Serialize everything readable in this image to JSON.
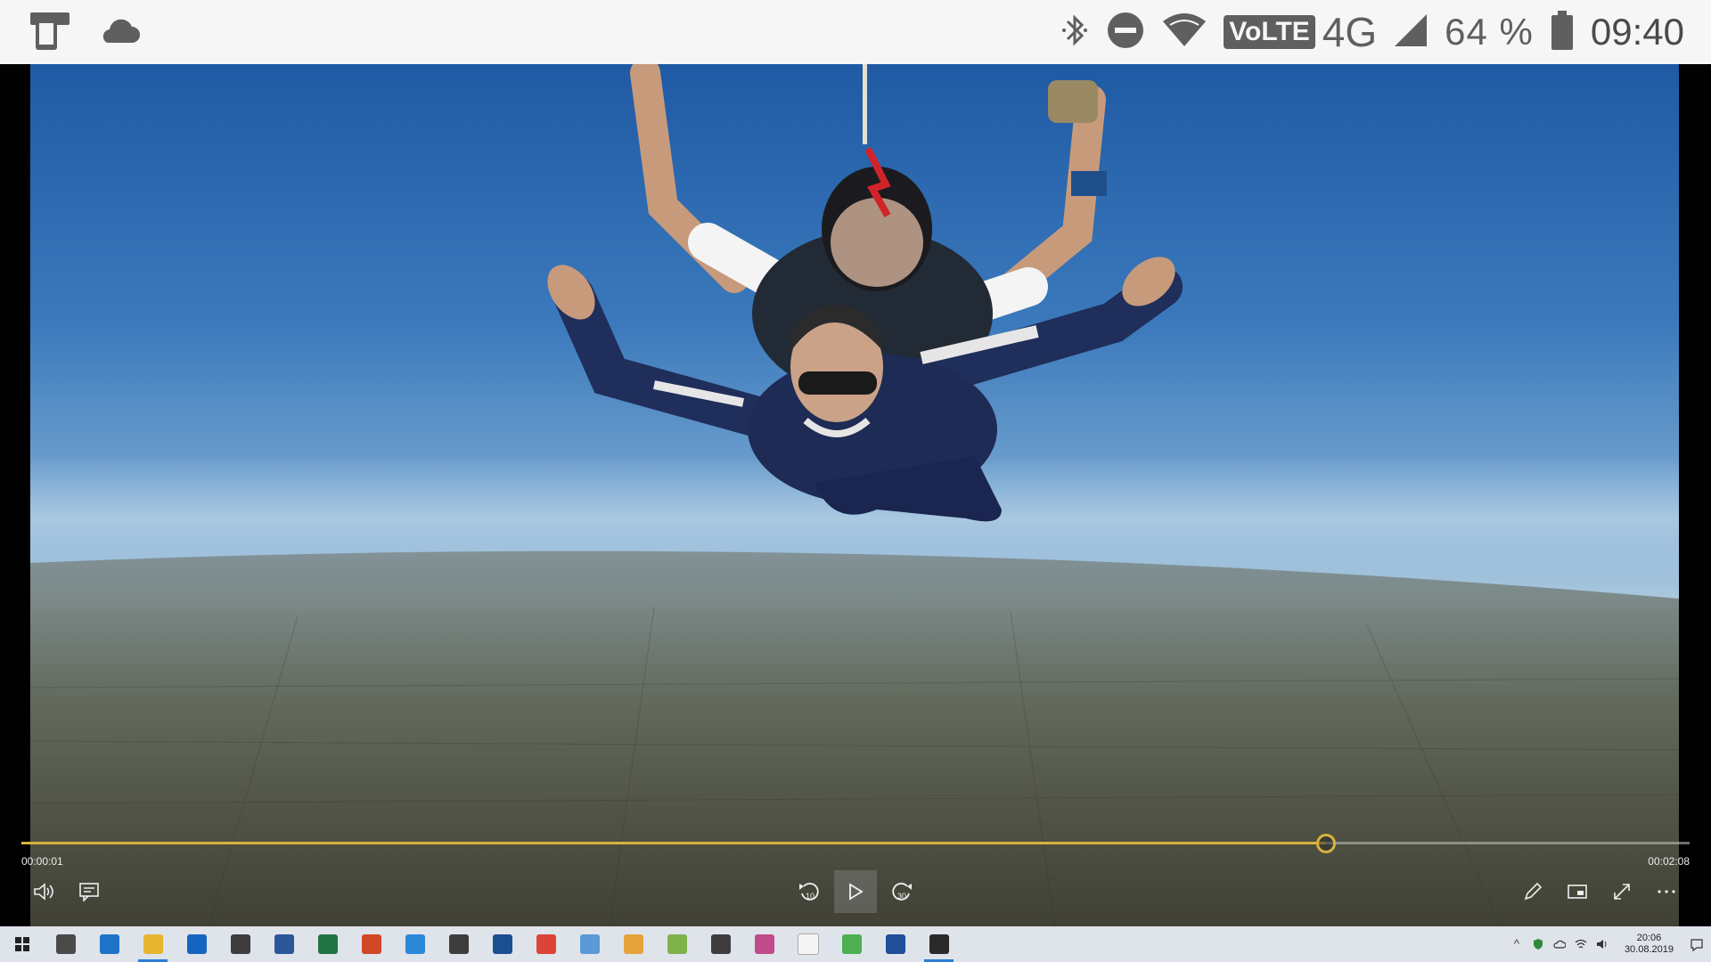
{
  "statusbar": {
    "volte": "VoLTE",
    "network": "4G",
    "battery": "64 %",
    "time": "09:40"
  },
  "player": {
    "elapsed": "00:00:01",
    "duration": "00:02:08",
    "progress": 0.782,
    "rewind_label": "10",
    "forward_label": "30"
  },
  "taskbar": {
    "clock_time": "20:06",
    "clock_date": "30.08.2019",
    "apps": [
      {
        "name": "task-view-button",
        "color": "#4a4a4a"
      },
      {
        "name": "edge-app",
        "color": "#1e73c8"
      },
      {
        "name": "file-explorer-app",
        "color": "#e8b530"
      },
      {
        "name": "outlook-app",
        "color": "#1565c0"
      },
      {
        "name": "mail-app",
        "color": "#3d3d3d"
      },
      {
        "name": "word-app",
        "color": "#2b579a"
      },
      {
        "name": "excel-app",
        "color": "#217346"
      },
      {
        "name": "powerpoint-app",
        "color": "#d24726"
      },
      {
        "name": "remote-desktop-app",
        "color": "#2b88d8"
      },
      {
        "name": "settings-app",
        "color": "#3d3d3d"
      },
      {
        "name": "store-app",
        "color": "#1b4f8f"
      },
      {
        "name": "chrome-app",
        "color": "#db4437"
      },
      {
        "name": "messaging-app",
        "color": "#5a9ad6"
      },
      {
        "name": "media-app",
        "color": "#e6a33a"
      },
      {
        "name": "paint-app",
        "color": "#7db34a"
      },
      {
        "name": "calculator-app",
        "color": "#3d3d3d"
      },
      {
        "name": "photos-app",
        "color": "#c04a8a"
      },
      {
        "name": "onedrive-app",
        "color": "#f5f5f5"
      },
      {
        "name": "chat-app",
        "color": "#4caf50"
      },
      {
        "name": "camera-app",
        "color": "#1f4f9a"
      },
      {
        "name": "movies-app",
        "color": "#2a2a2a"
      }
    ]
  }
}
